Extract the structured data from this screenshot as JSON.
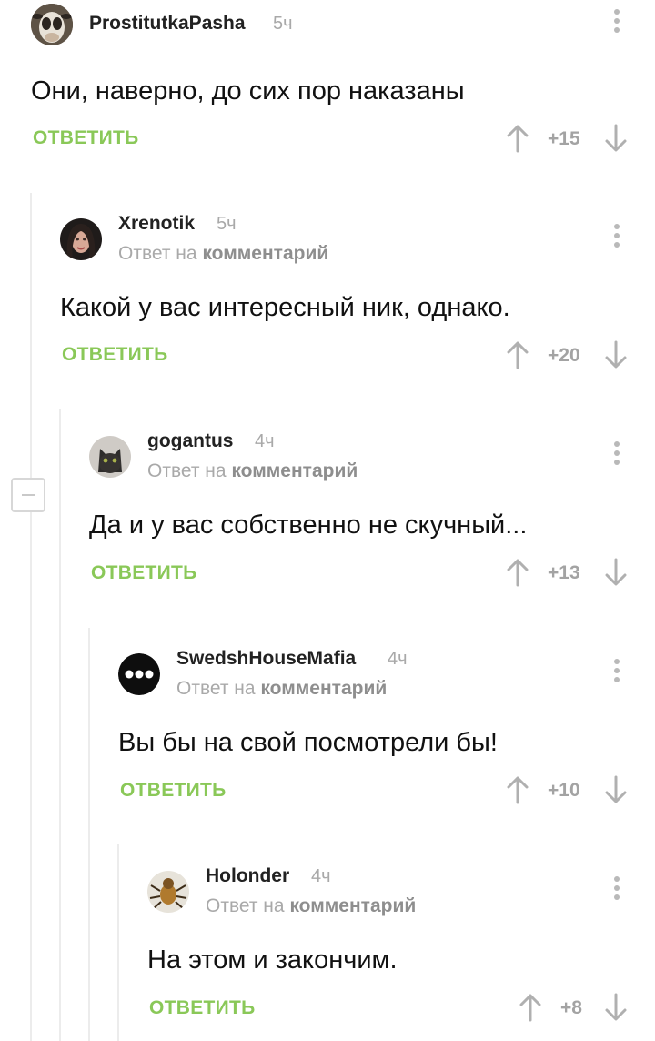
{
  "comments": [
    {
      "username": "ProstitutkaPasha",
      "time": "5ч",
      "text": "Они, наверно, до сих пор наказаны",
      "reply_label": "ОТВЕТИТЬ",
      "score": "+15",
      "avatar": "cow-avatar"
    },
    {
      "username": "Xrenotik",
      "time": "5ч",
      "reply_prefix": "Ответ на",
      "reply_link": "комментарий",
      "text": "Какой у вас интересный ник, однако.",
      "reply_label": "ОТВЕТИТЬ",
      "score": "+20",
      "avatar": "woman-avatar"
    },
    {
      "username": "gogantus",
      "time": "4ч",
      "reply_prefix": "Ответ на",
      "reply_link": "комментарий",
      "text": "Да и у вас собственно не скучный...",
      "reply_label": "ОТВЕТИТЬ",
      "score": "+13",
      "avatar": "cat-avatar"
    },
    {
      "username": "SwedshHouseMafia",
      "time": "4ч",
      "reply_prefix": "Ответ на",
      "reply_link": "комментарий",
      "text": "Вы бы на свой посмотрели бы!",
      "reply_label": "ОТВЕТИТЬ",
      "score": "+10",
      "avatar": "dots-logo-avatar"
    },
    {
      "username": "Holonder",
      "time": "4ч",
      "reply_prefix": "Ответ на",
      "reply_link": "комментарий",
      "text": "На этом и закончим.",
      "reply_label": "ОТВЕТИТЬ",
      "score": "+8",
      "avatar": "insect-avatar"
    }
  ],
  "icons": {
    "vote_up": "arrow-up-icon",
    "vote_down": "arrow-down-icon",
    "menu": "kebab-menu-icon",
    "collapse": "minus-icon"
  },
  "colors": {
    "accent_green": "#8ac858",
    "muted_text": "#a9a9a9",
    "score_gray": "#a3a3a3"
  }
}
